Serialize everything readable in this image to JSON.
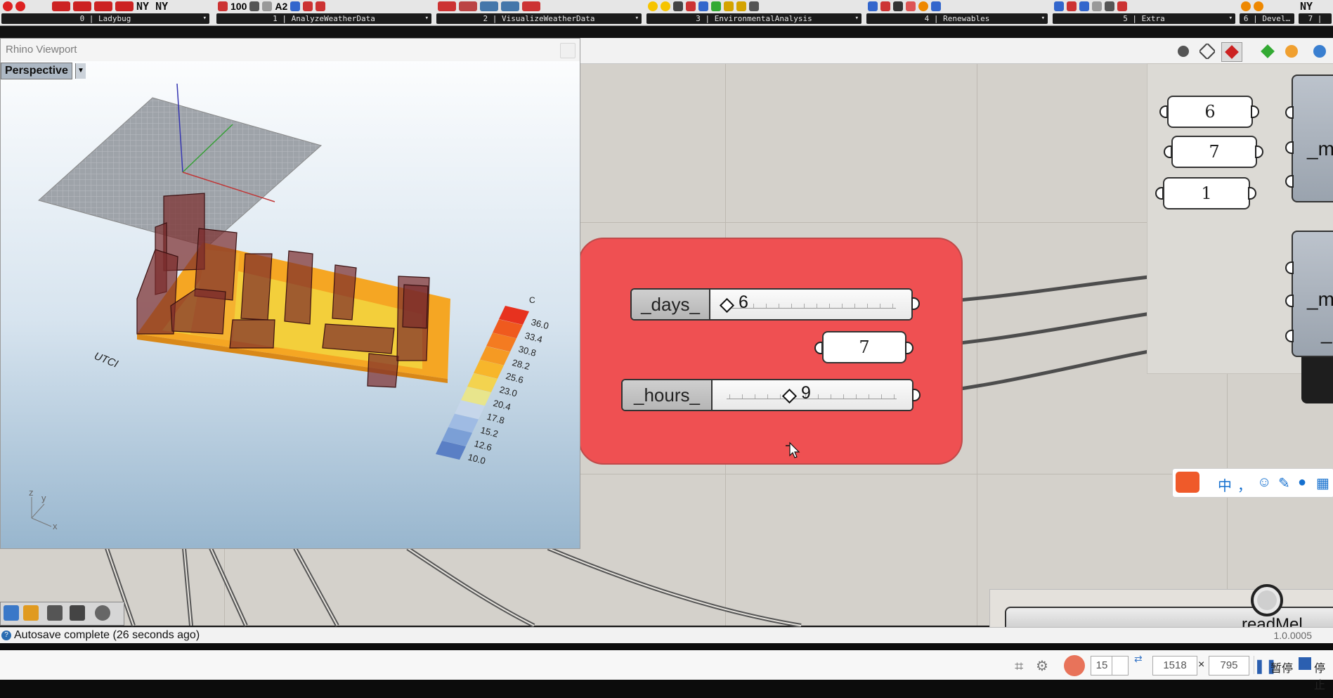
{
  "ribbon": {
    "tabs": [
      {
        "label": "0 | Ladybug"
      },
      {
        "label": "1 | AnalyzeWeatherData"
      },
      {
        "label": "2 | VisualizeWeatherData"
      },
      {
        "label": "3 | EnvironmentalAnalysis"
      },
      {
        "label": "4 | Renewables"
      },
      {
        "label": "5 | Extra"
      },
      {
        "label": "6 | Devel…"
      },
      {
        "label": "7 |"
      }
    ],
    "ny_text": "NY NY",
    "ny_small": "NY",
    "num_100": "100",
    "a2": "A2"
  },
  "viewport": {
    "window_title": "Rhino Viewport",
    "view_name": "Perspective",
    "model_label": "UTCI",
    "legend_unit": "C",
    "legend_values": [
      "36.0",
      "33.4",
      "30.8",
      "28.2",
      "25.6",
      "23.0",
      "20.4",
      "17.8",
      "15.2",
      "12.6",
      "10.0"
    ],
    "legend_colors": [
      "#e7321f",
      "#ef5a1e",
      "#f47b21",
      "#f59a23",
      "#f7b62b",
      "#f3d34f",
      "#e8e58c",
      "#c6d6ea",
      "#9fbbe3",
      "#7b9fd6",
      "#5a7fc5"
    ],
    "axis_z": "z",
    "axis_y": "y",
    "axis_x": "x"
  },
  "group": {
    "days": {
      "name": "_days_",
      "value": "6"
    },
    "panel_mid": "7",
    "hours": {
      "name": "_hours_",
      "value": "9"
    }
  },
  "right_panels": {
    "p1": "6",
    "p2": "7",
    "p3": "1",
    "comp_label_m1": "_mo",
    "comp_label_m2": "_mo",
    "comp_label_small": "_",
    "readmel": "readMel"
  },
  "ime": {
    "zh": "中",
    "comma": "，"
  },
  "status": {
    "text": "Autosave complete (26 seconds ago)",
    "version": "1.0.0005"
  },
  "recorder": {
    "fps": "15",
    "width": "1518",
    "times": "×",
    "height": "795",
    "pause": "暂停",
    "stop": "停止"
  }
}
